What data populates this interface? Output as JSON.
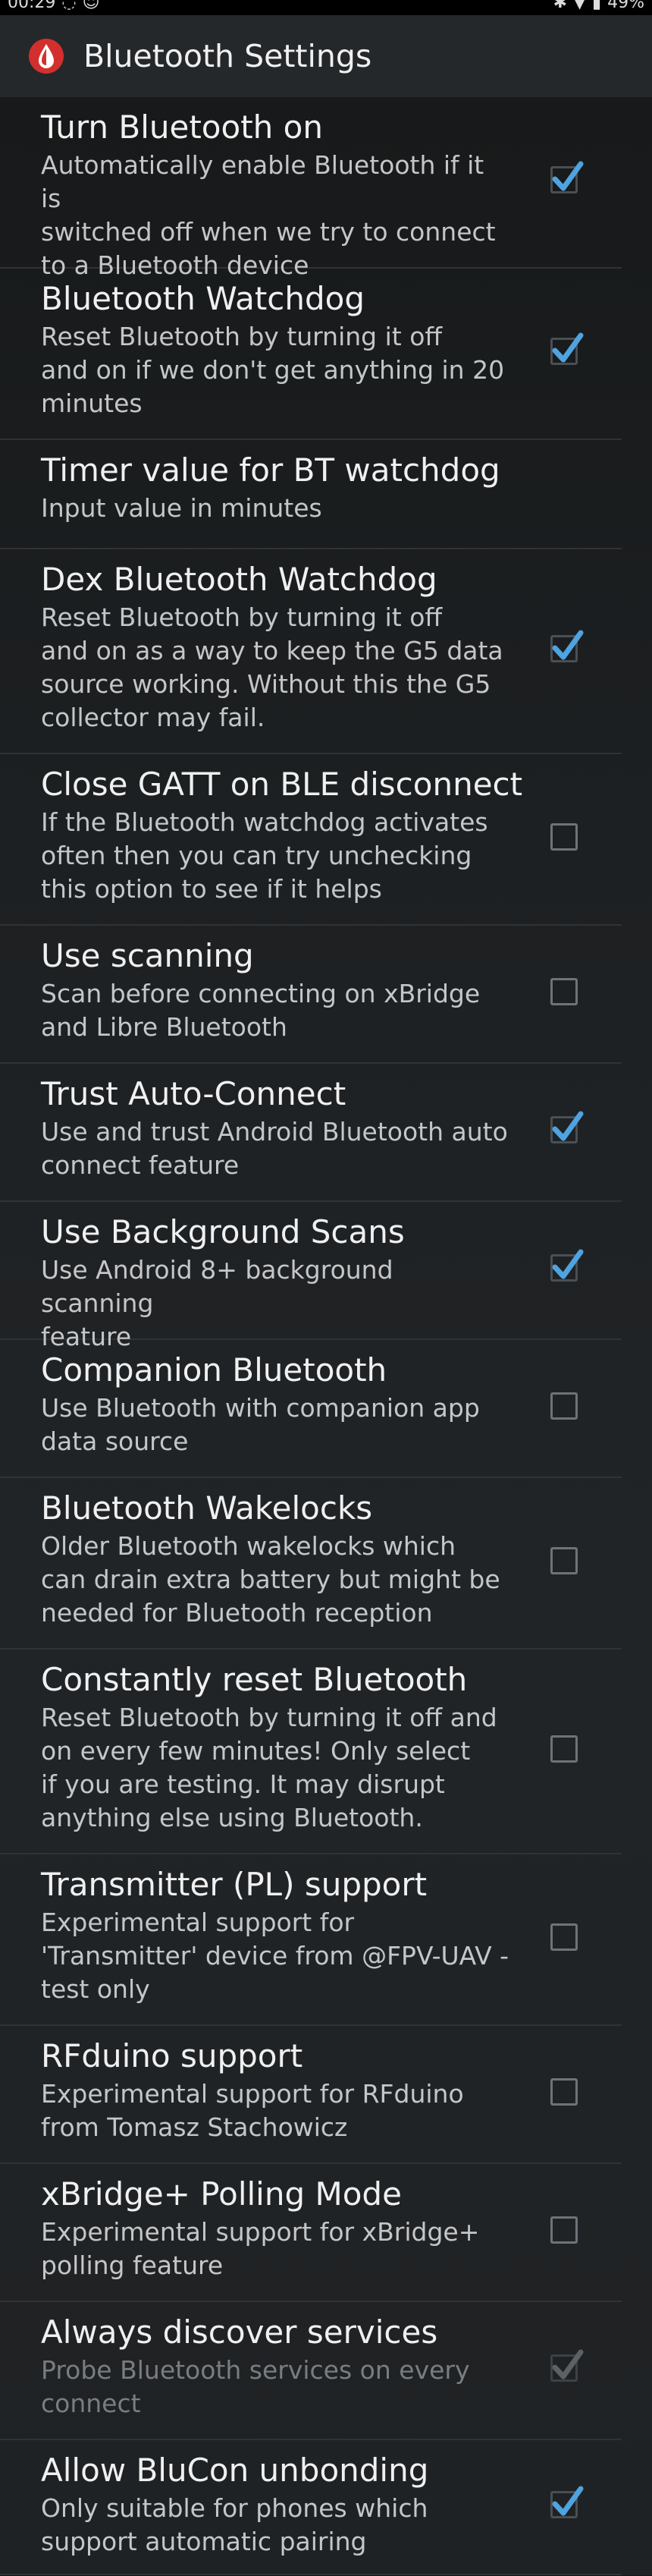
{
  "status_bar": {
    "time": "00:29",
    "battery": "49%"
  },
  "app_bar": {
    "icon": "xdrip-drop-icon",
    "title": "Bluetooth Settings"
  },
  "colors": {
    "accent": "#4fa3e0",
    "app_icon": "#d32f2f"
  },
  "preferences": [
    {
      "title": "Turn Bluetooth on",
      "summary": "Automatically enable Bluetooth if it is\nswitched off when we try to connect\nto a Bluetooth device",
      "checked": true,
      "enabled": true
    },
    {
      "title": "Bluetooth Watchdog",
      "summary": "Reset Bluetooth by turning it off\nand on if we don't get anything in 20\nminutes",
      "checked": true,
      "enabled": true
    },
    {
      "title": "Timer value for BT watchdog",
      "summary": "Input value in minutes",
      "checked": null,
      "enabled": true
    },
    {
      "title": "Dex Bluetooth Watchdog",
      "summary": "Reset Bluetooth by turning it off\nand on as a way to keep the G5 data\nsource working. Without this the G5\ncollector may fail.",
      "checked": true,
      "enabled": true
    },
    {
      "title": "Close GATT on BLE disconnect",
      "summary": "If the Bluetooth watchdog activates\noften then you can try unchecking\nthis option to see if it helps",
      "checked": false,
      "enabled": true
    },
    {
      "title": "Use scanning",
      "summary": "Scan before connecting on xBridge\nand Libre Bluetooth",
      "checked": false,
      "enabled": true
    },
    {
      "title": "Trust Auto-Connect",
      "summary": "Use and trust Android Bluetooth auto\nconnect feature",
      "checked": true,
      "enabled": true
    },
    {
      "title": "Use Background Scans",
      "summary": "Use Android 8+ background scanning\nfeature",
      "checked": true,
      "enabled": true
    },
    {
      "title": "Companion Bluetooth",
      "summary": "Use Bluetooth with companion app\ndata source",
      "checked": false,
      "enabled": true
    },
    {
      "title": "Bluetooth Wakelocks",
      "summary": "Older Bluetooth wakelocks which\ncan drain extra battery but might be\nneeded for Bluetooth reception",
      "checked": false,
      "enabled": true
    },
    {
      "title": "Constantly reset Bluetooth",
      "summary": "Reset Bluetooth by turning it off and\non every few minutes! Only select\nif you are testing. It may disrupt\nanything else using Bluetooth.",
      "checked": false,
      "enabled": true
    },
    {
      "title": "Transmitter (PL) support",
      "summary": "Experimental support for\n'Transmitter' device from @FPV-UAV -\ntest only",
      "checked": false,
      "enabled": true
    },
    {
      "title": "RFduino support",
      "summary": "Experimental support for RFduino\nfrom Tomasz Stachowicz",
      "checked": false,
      "enabled": true
    },
    {
      "title": "xBridge+ Polling Mode",
      "summary": "Experimental support for xBridge+\npolling feature",
      "checked": false,
      "enabled": true
    },
    {
      "title": "Always discover services",
      "summary": "Probe Bluetooth services on every\nconnect",
      "checked": true,
      "enabled": false
    },
    {
      "title": "Allow BluCon unbonding",
      "summary": "Only suitable for phones which\nsupport automatic pairing",
      "checked": true,
      "enabled": true
    }
  ]
}
